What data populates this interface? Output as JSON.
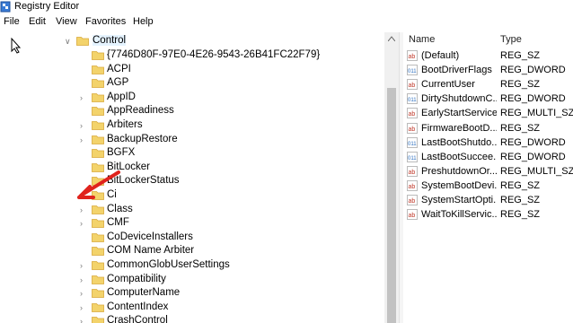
{
  "window": {
    "title": "Registry Editor"
  },
  "menu": [
    "File",
    "Edit",
    "View",
    "Favorites",
    "Help"
  ],
  "tree": {
    "parent": "Control",
    "children": [
      {
        "label": "{7746D80F-97E0-4E26-9543-26B41FC22F79}",
        "expandable": false
      },
      {
        "label": "ACPI",
        "expandable": false
      },
      {
        "label": "AGP",
        "expandable": false
      },
      {
        "label": "AppID",
        "expandable": true
      },
      {
        "label": "AppReadiness",
        "expandable": false
      },
      {
        "label": "Arbiters",
        "expandable": true
      },
      {
        "label": "BackupRestore",
        "expandable": true
      },
      {
        "label": "BGFX",
        "expandable": false
      },
      {
        "label": "BitLocker",
        "expandable": false
      },
      {
        "label": "BitLockerStatus",
        "expandable": false
      },
      {
        "label": "Ci",
        "expandable": true
      },
      {
        "label": "Class",
        "expandable": true
      },
      {
        "label": "CMF",
        "expandable": true
      },
      {
        "label": "CoDeviceInstallers",
        "expandable": false
      },
      {
        "label": "COM Name Arbiter",
        "expandable": false
      },
      {
        "label": "CommonGlobUserSettings",
        "expandable": true
      },
      {
        "label": "Compatibility",
        "expandable": true
      },
      {
        "label": "ComputerName",
        "expandable": true
      },
      {
        "label": "ContentIndex",
        "expandable": true
      },
      {
        "label": "CrashControl",
        "expandable": true
      }
    ]
  },
  "list": {
    "headers": {
      "name": "Name",
      "type": "Type"
    },
    "rows": [
      {
        "name": "(Default)",
        "type": "REG_SZ",
        "icon": "string-value-icon"
      },
      {
        "name": "BootDriverFlags",
        "type": "REG_DWORD",
        "icon": "binary-value-icon"
      },
      {
        "name": "CurrentUser",
        "type": "REG_SZ",
        "icon": "string-value-icon"
      },
      {
        "name": "DirtyShutdownC...",
        "type": "REG_DWORD",
        "icon": "binary-value-icon"
      },
      {
        "name": "EarlyStartServices",
        "type": "REG_MULTI_SZ",
        "icon": "string-value-icon"
      },
      {
        "name": "FirmwareBootD...",
        "type": "REG_SZ",
        "icon": "string-value-icon"
      },
      {
        "name": "LastBootShutdo...",
        "type": "REG_DWORD",
        "icon": "binary-value-icon"
      },
      {
        "name": "LastBootSuccee...",
        "type": "REG_DWORD",
        "icon": "binary-value-icon"
      },
      {
        "name": "PreshutdownOr...",
        "type": "REG_MULTI_SZ",
        "icon": "string-value-icon"
      },
      {
        "name": "SystemBootDevi...",
        "type": "REG_SZ",
        "icon": "string-value-icon"
      },
      {
        "name": "SystemStartOpti...",
        "type": "REG_SZ",
        "icon": "string-value-icon"
      },
      {
        "name": "WaitToKillServic...",
        "type": "REG_SZ",
        "icon": "string-value-icon"
      }
    ]
  },
  "colors": {
    "folder": "#f3d36b",
    "folderEdge": "#d9a93a",
    "stringIcon": "#c0392b",
    "binaryIcon": "#2c6fbf",
    "annotation": "#e0231d"
  }
}
